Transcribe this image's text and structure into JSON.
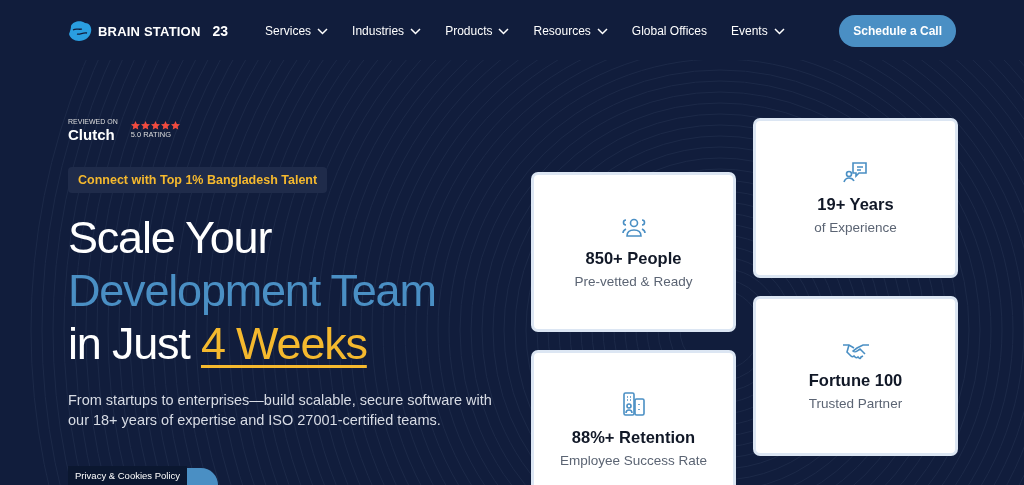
{
  "header": {
    "brand": "BRAIN STATION",
    "brand_number": "23",
    "nav": [
      {
        "label": "Services",
        "has_menu": true
      },
      {
        "label": "Industries",
        "has_menu": true
      },
      {
        "label": "Products",
        "has_menu": true
      },
      {
        "label": "Resources",
        "has_menu": true
      },
      {
        "label": "Global Offices",
        "has_menu": false
      },
      {
        "label": "Events",
        "has_menu": true
      }
    ],
    "cta": "Schedule a Call"
  },
  "hero": {
    "review": {
      "caption": "REVIEWED ON",
      "platform": "Clutch",
      "stars": 5,
      "rating": "5.0 RATING"
    },
    "tag": "Connect with Top 1% Bangladesh Talent",
    "headline": [
      [
        {
          "text": "Scale Your",
          "color": "#ffffff",
          "underlined": false
        }
      ],
      [
        {
          "text": "Development Team",
          "color": "#4a8fc4",
          "underlined": false
        }
      ],
      [
        {
          "text": "in Just ",
          "color": "#ffffff",
          "underlined": false
        },
        {
          "text": "4 Weeks",
          "color": "#f5b92e",
          "underlined": true
        }
      ]
    ],
    "description": "From startups to enterprises—build scalable, secure software with our 18+ years of expertise and ISO 27001-certified teams."
  },
  "stats": [
    {
      "title": "850+ People",
      "subtitle": "Pre-vetted & Ready"
    },
    {
      "title": "88%+ Retention",
      "subtitle": "Employee Success Rate"
    },
    {
      "title": "19+ Years",
      "subtitle": "of Experience"
    },
    {
      "title": "Fortune 100",
      "subtitle": "Trusted Partner"
    }
  ],
  "cookie_badge": "Privacy & Cookies Policy"
}
